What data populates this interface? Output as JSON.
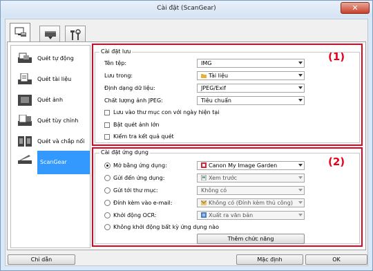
{
  "window": {
    "title": "Cài đặt (ScanGear)",
    "close": "✕"
  },
  "tabs": [
    {
      "name": "scan-from-computer-tab",
      "icon": "computer-scanner-icon"
    },
    {
      "name": "scan-from-operation-panel-tab",
      "icon": "scanner-icon"
    },
    {
      "name": "general-settings-tab",
      "icon": "tools-icon"
    }
  ],
  "sidebar": {
    "items": [
      {
        "label": "Quét tự động",
        "icon": "auto-scan-icon"
      },
      {
        "label": "Quét tài liệu",
        "icon": "document-scan-icon"
      },
      {
        "label": "Quét ảnh",
        "icon": "photo-scan-icon"
      },
      {
        "label": "Quét tùy chỉnh",
        "icon": "custom-scan-icon"
      },
      {
        "label": "Quét và chắp nối",
        "icon": "stitch-scan-icon"
      },
      {
        "label": "ScanGear",
        "icon": "scangear-icon"
      }
    ]
  },
  "save_settings": {
    "title": "Cài đặt lưu",
    "marker": "(1)",
    "file_name_label": "Tên tệp:",
    "file_name_value": "IMG",
    "save_in_label": "Lưu trong:",
    "save_in_value": "Tài liệu",
    "format_label": "Định dạng dữ liệu:",
    "format_value": "JPEG/Exif",
    "jpeg_quality_label": "Chất lượng ảnh JPEG:",
    "jpeg_quality_value": "Tiêu chuẩn",
    "cb_subfolder": "Lưu vào thư mục con với ngày hiện tại",
    "cb_large_scan": "Bật quét ảnh lớn",
    "cb_check_results": "Kiểm tra kết quả quét"
  },
  "app_settings": {
    "title": "Cài đặt ứng dụng",
    "marker": "(2)",
    "rows": [
      {
        "label": "Mở bằng ứng dụng:",
        "value": "Canon My Image Garden",
        "selected": true
      },
      {
        "label": "Gửi đến ứng dụng:",
        "value": "Xem trước",
        "selected": false
      },
      {
        "label": "Gửi tới thư mục:",
        "value": "Không có",
        "selected": false
      },
      {
        "label": "Đính kèm vào e-mail:",
        "value": "Không có (Đính kèm thủ công)",
        "selected": false
      },
      {
        "label": "Khởi động OCR:",
        "value": "Xuất ra văn bản",
        "selected": false
      }
    ],
    "no_app_label": "Không khởi động bất kỳ ứng dụng nào",
    "more_functions": "Thêm chức năng"
  },
  "footer": {
    "help": "Chỉ dẫn",
    "defaults": "Mặc định",
    "ok": "OK"
  },
  "colors": {
    "highlight": "#3399ff",
    "annotation": "#e8001c"
  }
}
